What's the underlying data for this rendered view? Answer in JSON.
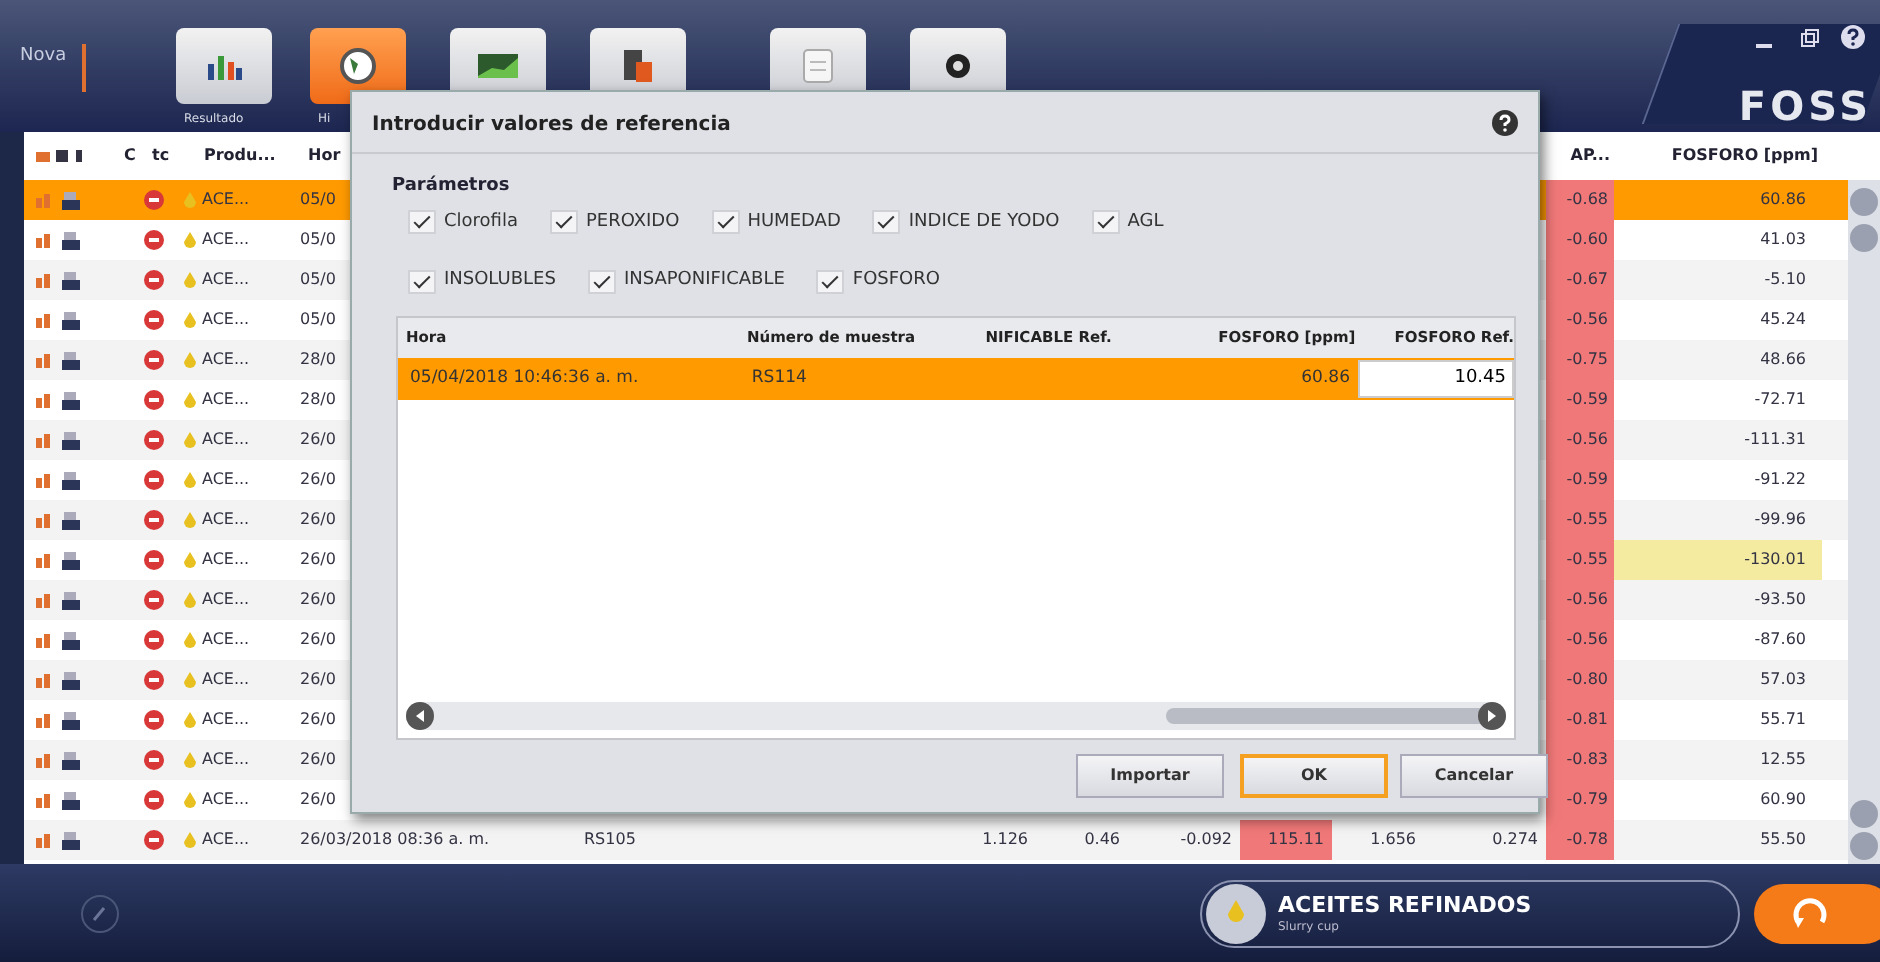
{
  "app": {
    "logo": "Nova",
    "brand": "FOSS",
    "toolbar": [
      {
        "label": "Resultado",
        "selected": false
      },
      {
        "label": "Hi",
        "selected": true
      },
      {
        "selected": false
      },
      {
        "selected": false
      },
      {
        "selected": false
      },
      {
        "selected": false
      }
    ]
  },
  "table": {
    "columns": [
      "C",
      "tc",
      "Produ...",
      "Hor",
      "AP...",
      "FOSFORO [ppm]"
    ],
    "rows": [
      {
        "product": "ACE...",
        "time": "05/0",
        "sap": "-0.68",
        "fosforo": "60.86",
        "selected": true,
        "flagged": false
      },
      {
        "product": "ACE...",
        "time": "05/0",
        "sap": "-0.60",
        "fosforo": "41.03",
        "selected": false,
        "flagged": false
      },
      {
        "product": "ACE...",
        "time": "05/0",
        "sap": "-0.67",
        "fosforo": "-5.10",
        "selected": false,
        "flagged": false
      },
      {
        "product": "ACE...",
        "time": "05/0",
        "sap": "-0.56",
        "fosforo": "45.24",
        "selected": false,
        "flagged": false
      },
      {
        "product": "ACE...",
        "time": "28/0",
        "sap": "-0.75",
        "fosforo": "48.66",
        "selected": false,
        "flagged": false
      },
      {
        "product": "ACE...",
        "time": "28/0",
        "sap": "-0.59",
        "fosforo": "-72.71",
        "selected": false,
        "flagged": false
      },
      {
        "product": "ACE...",
        "time": "26/0",
        "sap": "-0.56",
        "fosforo": "-111.31",
        "selected": false,
        "flagged": false
      },
      {
        "product": "ACE...",
        "time": "26/0",
        "sap": "-0.59",
        "fosforo": "-91.22",
        "selected": false,
        "flagged": false
      },
      {
        "product": "ACE...",
        "time": "26/0",
        "sap": "-0.55",
        "fosforo": "-99.96",
        "selected": false,
        "flagged": false
      },
      {
        "product": "ACE...",
        "time": "26/0",
        "sap": "-0.55",
        "fosforo": "-130.01",
        "selected": false,
        "flagged": true
      },
      {
        "product": "ACE...",
        "time": "26/0",
        "sap": "-0.56",
        "fosforo": "-93.50",
        "selected": false,
        "flagged": false
      },
      {
        "product": "ACE...",
        "time": "26/0",
        "sap": "-0.56",
        "fosforo": "-87.60",
        "selected": false,
        "flagged": false
      },
      {
        "product": "ACE...",
        "time": "26/0",
        "sap": "-0.80",
        "fosforo": "57.03",
        "selected": false,
        "flagged": false
      },
      {
        "product": "ACE...",
        "time": "26/0",
        "sap": "-0.81",
        "fosforo": "55.71",
        "selected": false,
        "flagged": false
      },
      {
        "product": "ACE...",
        "time": "26/0",
        "sap": "-0.83",
        "fosforo": "12.55",
        "selected": false,
        "flagged": false
      },
      {
        "product": "ACE...",
        "time": "26/0",
        "sap": "-0.79",
        "fosforo": "60.90",
        "selected": false,
        "flagged": false
      },
      {
        "product": "ACE...",
        "time": "26/03/2018 08:36 a. m.",
        "sample": "RS105",
        "values": [
          "1.126",
          "0.46",
          "-0.092",
          "115.11",
          "1.656",
          "0.274"
        ],
        "sap": "-0.78",
        "fosforo": "55.50",
        "selected": false,
        "flagged": false
      }
    ]
  },
  "dialog": {
    "title": "Introducir valores de referencia",
    "section": "Parámetros",
    "params": [
      {
        "label": "Clorofila",
        "checked": true
      },
      {
        "label": "PEROXIDO",
        "checked": true
      },
      {
        "label": "HUMEDAD",
        "checked": true
      },
      {
        "label": "INDICE DE YODO",
        "checked": true
      },
      {
        "label": "AGL",
        "checked": true
      },
      {
        "label": "INSOLUBLES",
        "checked": true
      },
      {
        "label": "INSAPONIFICABLE",
        "checked": true
      },
      {
        "label": "FOSFORO",
        "checked": true
      }
    ],
    "grid": {
      "columns": [
        "Hora",
        "Número de muestra",
        "NIFICABLE Ref.",
        "FOSFORO [ppm]",
        "FOSFORO Ref."
      ],
      "rows": [
        {
          "time": "05/04/2018 10:46:36 a. m.",
          "sample": "RS114",
          "col3": "",
          "fosforo": "60.86",
          "reference": "10.45",
          "selected": true
        }
      ]
    },
    "buttons": [
      {
        "label": "Importar",
        "selected": false
      },
      {
        "label": "OK",
        "selected": true
      },
      {
        "label": "Cancelar",
        "selected": false
      }
    ]
  },
  "footer": {
    "product": "ACEITES REFINADOS",
    "cup": "Slurry cup"
  }
}
